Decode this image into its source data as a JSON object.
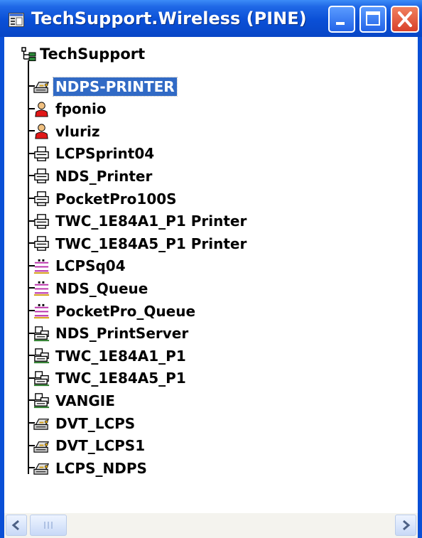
{
  "window": {
    "title": "TechSupport.Wireless (PINE)",
    "titlebar_color": "#0a4fd6",
    "selection_color": "#316ac5",
    "controls": [
      "minimize",
      "maximize",
      "close"
    ]
  },
  "tree": {
    "root": {
      "label": "TechSupport",
      "icon": "org-tree-icon"
    },
    "items": [
      {
        "label": "NDPS-PRINTER",
        "icon": "ndps-printer-icon",
        "selected": true
      },
      {
        "label": "fponio",
        "icon": "user-icon"
      },
      {
        "label": "vluriz",
        "icon": "user-icon"
      },
      {
        "label": "LCPSprint04",
        "icon": "printer-icon"
      },
      {
        "label": "NDS_Printer",
        "icon": "printer-icon"
      },
      {
        "label": "PocketPro100S",
        "icon": "printer-icon"
      },
      {
        "label": "TWC_1E84A1_P1 Printer",
        "icon": "printer-icon"
      },
      {
        "label": "TWC_1E84A5_P1 Printer",
        "icon": "printer-icon"
      },
      {
        "label": "LCPSq04",
        "icon": "print-queue-icon"
      },
      {
        "label": "NDS_Queue",
        "icon": "print-queue-icon"
      },
      {
        "label": "PocketPro_Queue",
        "icon": "print-queue-icon"
      },
      {
        "label": "NDS_PrintServer",
        "icon": "print-server-icon"
      },
      {
        "label": "TWC_1E84A1_P1",
        "icon": "print-server-icon"
      },
      {
        "label": "TWC_1E84A5_P1",
        "icon": "print-server-icon"
      },
      {
        "label": "VANGIE",
        "icon": "print-server-icon"
      },
      {
        "label": "DVT_LCPS",
        "icon": "ndps-printer-icon"
      },
      {
        "label": "DVT_LCPS1",
        "icon": "ndps-printer-icon"
      },
      {
        "label": "LCPS_NDPS",
        "icon": "ndps-printer-icon"
      }
    ]
  },
  "scrollbar": {
    "left_arrow": "scroll-left-icon",
    "right_arrow": "scroll-right-icon"
  }
}
